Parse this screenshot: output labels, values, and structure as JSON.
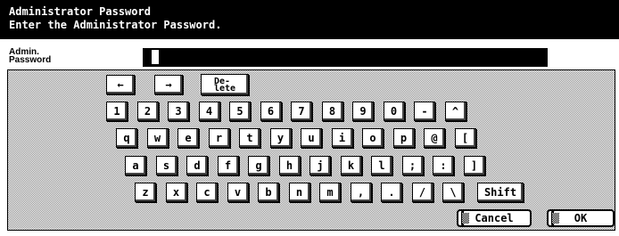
{
  "title": {
    "line1": "Administrator Password",
    "line2": "Enter the Administrator Password."
  },
  "password": {
    "label_line1": "Admin.",
    "label_line2": "Password",
    "value": ""
  },
  "keys": {
    "left_arrow": "←",
    "right_arrow": "→",
    "delete_line1": "De-",
    "delete_line2": "lete",
    "row1": [
      "1",
      "2",
      "3",
      "4",
      "5",
      "6",
      "7",
      "8",
      "9",
      "0",
      "-",
      "^"
    ],
    "row2": [
      "q",
      "w",
      "e",
      "r",
      "t",
      "y",
      "u",
      "i",
      "o",
      "p",
      "@",
      "["
    ],
    "row3": [
      "a",
      "s",
      "d",
      "f",
      "g",
      "h",
      "j",
      "k",
      "l",
      ";",
      ":",
      "]"
    ],
    "row4": [
      "z",
      "x",
      "c",
      "v",
      "b",
      "n",
      "m",
      ",",
      ".",
      "/",
      "\\"
    ],
    "shift": "Shift"
  },
  "buttons": {
    "cancel": "Cancel",
    "ok": "OK"
  }
}
